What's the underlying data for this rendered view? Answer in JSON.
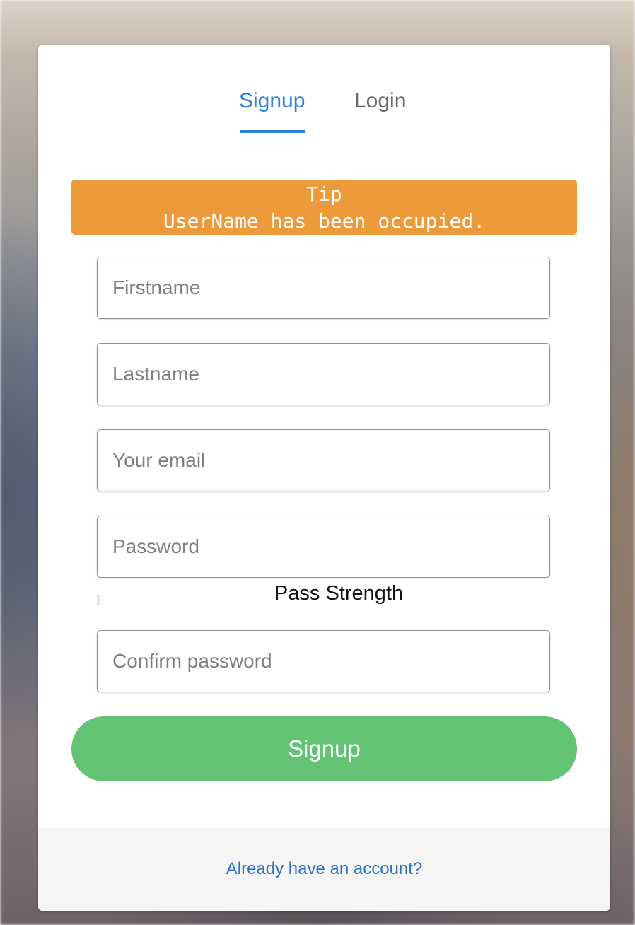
{
  "tabs": {
    "signup_label": "Signup",
    "login_label": "Login",
    "active": "Signup"
  },
  "alert": {
    "title": "Tip",
    "message": "UserName has been occupied."
  },
  "form": {
    "firstname_placeholder": "Firstname",
    "lastname_placeholder": "Lastname",
    "email_placeholder": "Your email",
    "password_placeholder": "Password",
    "strength_label": "Pass Strength",
    "confirm_placeholder": "Confirm password",
    "submit_label": "Signup"
  },
  "footer": {
    "link_label": "Already have an account?"
  },
  "colors": {
    "accent": "#2f82d3",
    "alert": "#ec9a3a",
    "submit": "#62c375",
    "link": "#2a74c2"
  }
}
